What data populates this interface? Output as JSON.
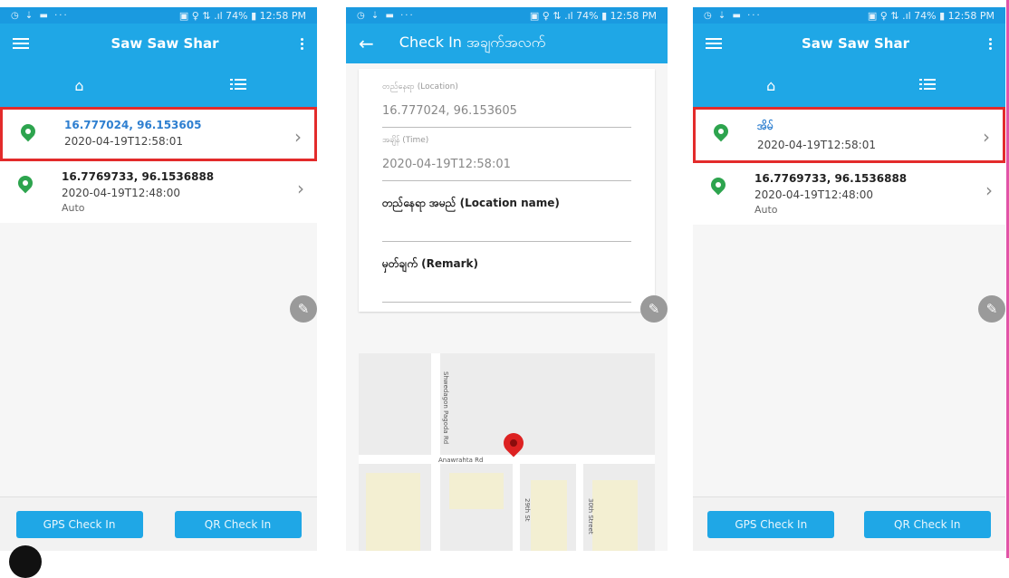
{
  "statusbar": {
    "left": "◷ ⇣ ▬ ···",
    "right": "▣ ♀ ⇅ .ıl 74% ▮ 12:58 PM"
  },
  "home": {
    "title": "Saw Saw Shar",
    "items": [
      {
        "coord": "16.777024, 96.153605",
        "date": "2020-04-19T12:58:01",
        "mode": ""
      },
      {
        "coord": "16.7769733, 96.1536888",
        "date": "2020-04-19T12:48:00",
        "mode": "Auto"
      }
    ],
    "gps_button": "GPS Check In",
    "qr_button": "QR Check In"
  },
  "checkin": {
    "title": "Check In အချက်အလက်",
    "location_label": "တည်နေရာ (Location)",
    "location_value": "16.777024, 96.153605",
    "time_label": "အချိန် (Time)",
    "time_value": "2020-04-19T12:58:01",
    "location_name_label": "တည်နေရာ အမည် (Location name)",
    "remark_label": "မှတ်ချက် (Remark)",
    "map_labels": {
      "road1": "Shwedagon Pagoda Rd",
      "road2": "Anawrahta Rd",
      "street1": "29th St",
      "street2": "30th Street"
    }
  },
  "home_updated": {
    "title": "Saw Saw Shar",
    "items": [
      {
        "coord": "အိမ်",
        "date": "2020-04-19T12:58:01",
        "mode": ""
      },
      {
        "coord": "16.7769733, 96.1536888",
        "date": "2020-04-19T12:48:00",
        "mode": "Auto"
      }
    ],
    "gps_button": "GPS Check In",
    "qr_button": "QR Check In"
  },
  "colors": {
    "primary": "#1fa7e6",
    "highlight": "#e32b2b",
    "pin": "#2da44e",
    "marker": "#dd2222"
  },
  "icons": [
    "menu-icon",
    "kebab-menu-icon",
    "home-icon",
    "list-icon",
    "location-pin-icon",
    "chevron-right-icon",
    "edit-icon",
    "back-arrow-icon",
    "map-marker-icon"
  ]
}
